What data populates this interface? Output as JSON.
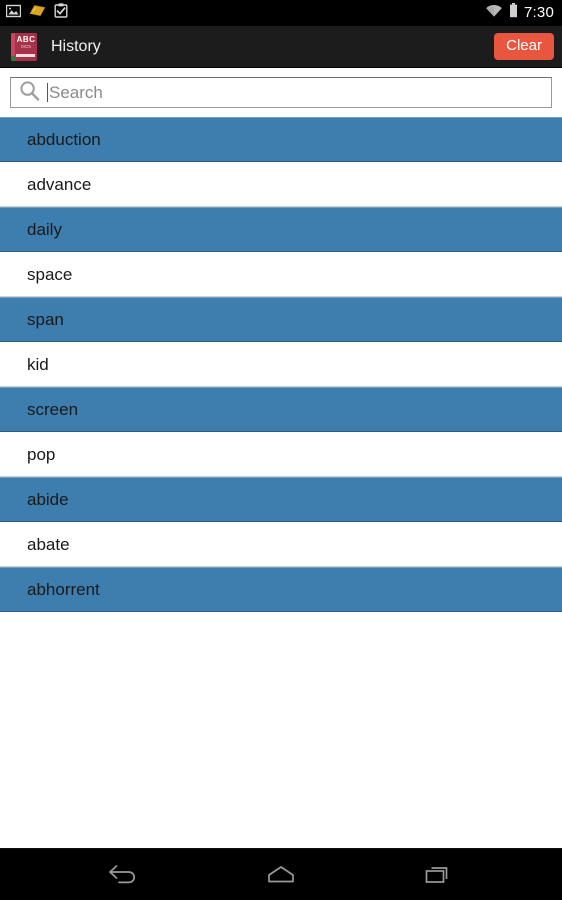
{
  "status_bar": {
    "icons": [
      "image-icon",
      "bookmark-book-icon",
      "clipboard-check-icon"
    ],
    "wifi_icon": "wifi-icon",
    "battery_icon": "battery-icon",
    "time": "7:30"
  },
  "action_bar": {
    "app_icon": "dictionary-book-icon",
    "app_icon_text": "ABC",
    "app_icon_subtext": "dicts",
    "title": "History",
    "clear_label": "Clear",
    "clear_color": "#e8563f",
    "background": "#1c1c1c"
  },
  "search": {
    "icon": "search-icon",
    "value": "",
    "placeholder": "Search"
  },
  "list": {
    "row_alt_color": "#3d7eaf",
    "items": [
      {
        "label": "abduction"
      },
      {
        "label": "advance"
      },
      {
        "label": "daily"
      },
      {
        "label": "space"
      },
      {
        "label": "span"
      },
      {
        "label": "kid"
      },
      {
        "label": "screen"
      },
      {
        "label": "pop"
      },
      {
        "label": "abide"
      },
      {
        "label": "abate"
      },
      {
        "label": "abhorrent"
      }
    ]
  },
  "nav_bar": {
    "back_label": "back-icon",
    "home_label": "home-icon",
    "recents_label": "recents-icon"
  }
}
